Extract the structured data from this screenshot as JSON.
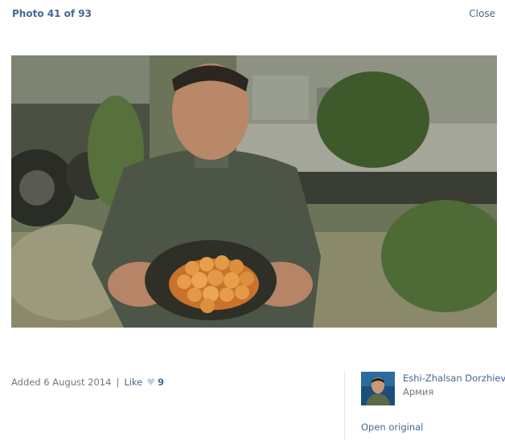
{
  "viewer": {
    "counter": "Photo 41 of 93",
    "close_label": "Close"
  },
  "photo": {
    "alt": "Photo"
  },
  "meta": {
    "added": "Added 6 August 2014",
    "separator": "|",
    "like_label": "Like",
    "like_icon": "heart-icon",
    "like_count": "9"
  },
  "author": {
    "name": "Eshi-Zhalsan Dorzhiev",
    "subtitle": "Армия"
  },
  "actions": {
    "open_original": "Open original"
  },
  "colors": {
    "link": "#45688e",
    "muted": "#777777",
    "heart": "#c5d0dc"
  }
}
